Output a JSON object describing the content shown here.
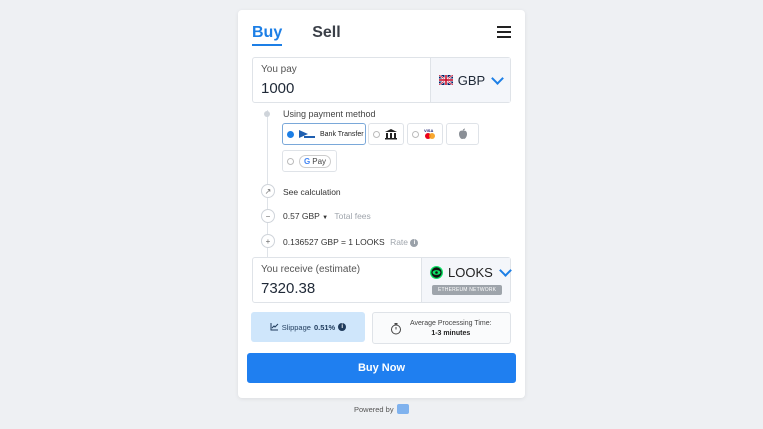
{
  "tabs": {
    "buy": "Buy",
    "sell": "Sell",
    "active": "buy"
  },
  "pay": {
    "label": "You pay",
    "amount": "1000",
    "currency": "GBP",
    "flag_icon": "uk-flag-icon"
  },
  "payment_method": {
    "label": "Using payment method",
    "options": [
      {
        "name": "Bank Transfer",
        "icon": "bank-transfer-icon",
        "selected": true
      },
      {
        "name": "",
        "icon": "openbanking-icon",
        "selected": false
      },
      {
        "name": "",
        "icon": "visa-mastercard-icon",
        "selected": false
      },
      {
        "name": "",
        "icon": "apple-pay-icon",
        "selected": false
      },
      {
        "name": "Pay",
        "icon": "google-pay-icon",
        "selected": false
      }
    ]
  },
  "calculation": {
    "label": "See calculation"
  },
  "fees": {
    "value": "0.57 GBP",
    "label": "Total fees"
  },
  "rate": {
    "value": "0.136527 GBP = 1 LOOKS",
    "label": "Rate"
  },
  "receive": {
    "label": "You receive (estimate)",
    "amount": "7320.38",
    "token": "LOOKS",
    "network": "ETHEREUM NETWORK"
  },
  "slippage": {
    "label": "Slippage",
    "value": "0.51%"
  },
  "processing": {
    "label": "Average Processing Time:",
    "value": "1-3 minutes"
  },
  "buy_button": "Buy Now",
  "footer": {
    "powered_by": "Powered by"
  },
  "colors": {
    "accent": "#1f7ff0",
    "slippage_bg": "#cfe6fb"
  }
}
